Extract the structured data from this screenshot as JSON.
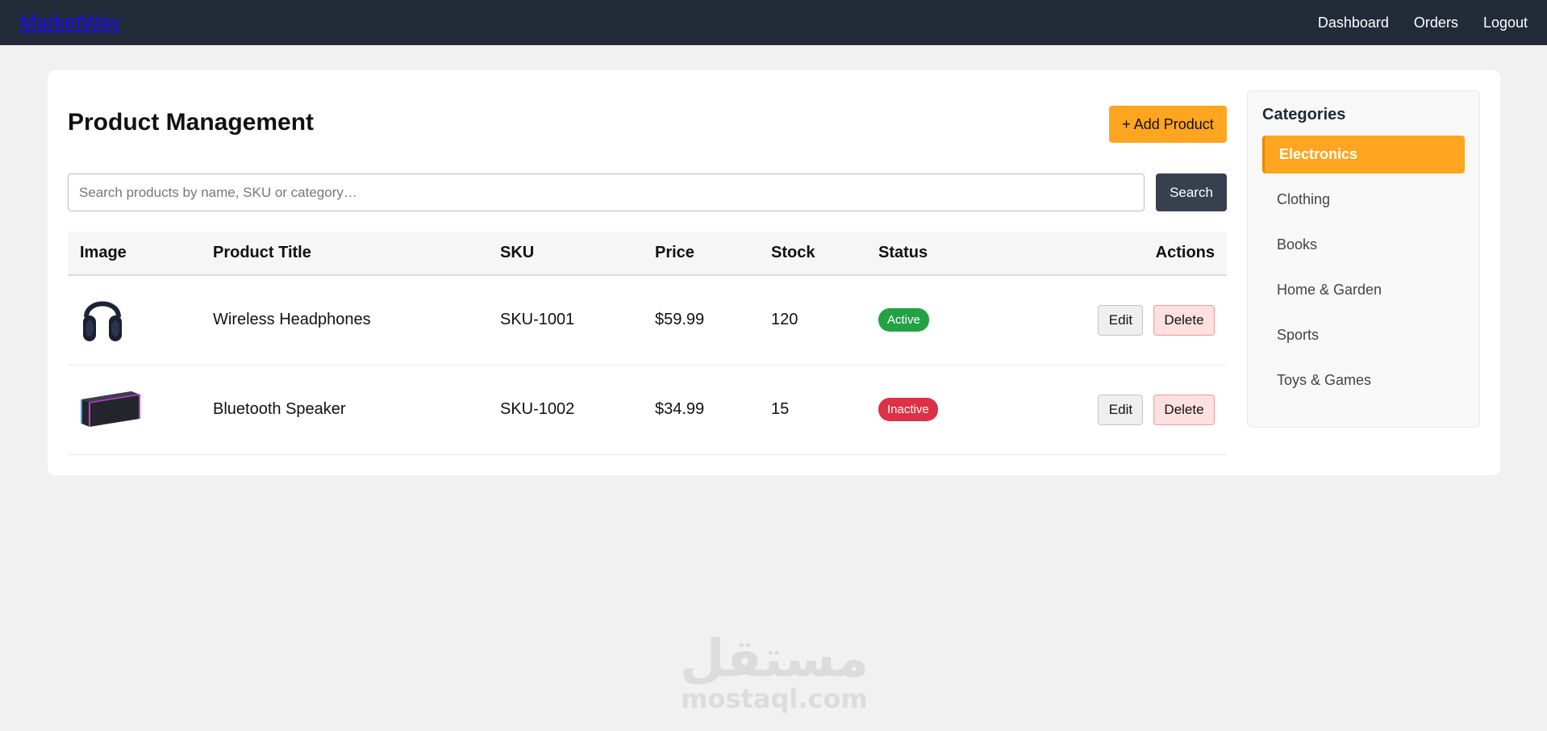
{
  "navbar": {
    "brand": "MarketWay",
    "links": [
      "Dashboard",
      "Orders",
      "Logout"
    ]
  },
  "main": {
    "title": "Product Management",
    "add_button": "+ Add Product",
    "search": {
      "placeholder": "Search products by name, SKU or category…",
      "button": "Search"
    },
    "table": {
      "headers": [
        "Image",
        "Product Title",
        "SKU",
        "Price",
        "Stock",
        "Status",
        "Actions"
      ],
      "rows": [
        {
          "image": "headphones-image",
          "title": "Wireless Headphones",
          "sku": "SKU-1001",
          "price": "$59.99",
          "stock": "120",
          "status": "Active",
          "edit": "Edit",
          "delete": "Delete"
        },
        {
          "image": "speaker-image",
          "title": "Bluetooth Speaker",
          "sku": "SKU-1002",
          "price": "$34.99",
          "stock": "15",
          "status": "Inactive",
          "edit": "Edit",
          "delete": "Delete"
        }
      ]
    }
  },
  "sidebar": {
    "title": "Categories",
    "items": [
      "Electronics",
      "Clothing",
      "Books",
      "Home & Garden",
      "Sports",
      "Toys & Games"
    ],
    "active": "Electronics"
  },
  "watermark": {
    "arabic": "مستقل",
    "latin": "mostaql.com"
  },
  "colors": {
    "navbar": "#222b38",
    "accent": "#ffa520",
    "active_badge": "#22a244",
    "inactive_badge": "#dc3146",
    "search_button": "#36404f"
  }
}
